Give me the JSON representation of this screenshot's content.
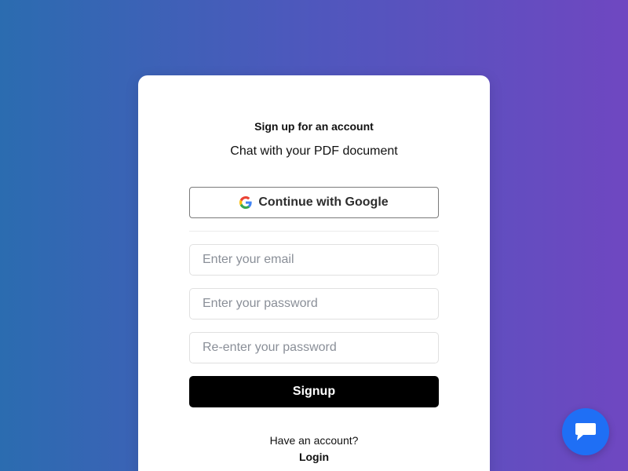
{
  "card": {
    "title": "Sign up for an account",
    "subtitle": "Chat with your PDF document"
  },
  "google": {
    "label": "Continue with Google",
    "icon": "google-icon"
  },
  "form": {
    "email_placeholder": "Enter your email",
    "password_placeholder": "Enter your password",
    "confirm_placeholder": "Re-enter your password",
    "submit_label": "Signup"
  },
  "footer": {
    "prompt": "Have an account?",
    "login_label": "Login"
  },
  "chat_widget": {
    "icon": "chat-bubble-icon"
  },
  "colors": {
    "background_start": "#2b6cb0",
    "background_end": "#6f47c1",
    "primary_button": "#000000",
    "chat_button": "#1f6ff5"
  }
}
